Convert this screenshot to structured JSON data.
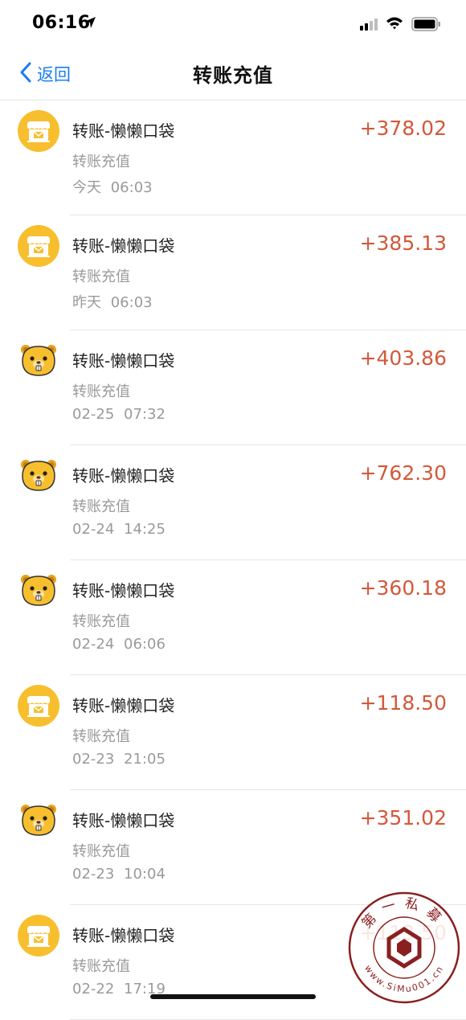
{
  "status": {
    "time": "06:16",
    "location_icon": "location-arrow-icon",
    "signal_icon": "cellular-signal-icon",
    "wifi_icon": "wifi-icon",
    "battery_icon": "battery-icon"
  },
  "nav": {
    "back_label": "返回",
    "title": "转账充值"
  },
  "colors": {
    "accent": "#1a7df5",
    "amount": "#d4583a",
    "secondary_text": "#9a9a9a",
    "icon_yellow": "#f7bf2e"
  },
  "transactions": [
    {
      "title": "转账-懒懒口袋",
      "subtitle": "转账充值",
      "time": "今天 06:03",
      "amount": "+378.02",
      "icon": "shop-icon"
    },
    {
      "title": "转账-懒懒口袋",
      "subtitle": "转账充值",
      "time": "昨天 06:03",
      "amount": "+385.13",
      "icon": "shop-icon"
    },
    {
      "title": "转账-懒懒口袋",
      "subtitle": "转账充值",
      "time": "02-25 07:32",
      "amount": "+403.86",
      "icon": "beaver-icon"
    },
    {
      "title": "转账-懒懒口袋",
      "subtitle": "转账充值",
      "time": "02-24 14:25",
      "amount": "+762.30",
      "icon": "beaver-icon"
    },
    {
      "title": "转账-懒懒口袋",
      "subtitle": "转账充值",
      "time": "02-24 06:06",
      "amount": "+360.18",
      "icon": "beaver-icon"
    },
    {
      "title": "转账-懒懒口袋",
      "subtitle": "转账充值",
      "time": "02-23 21:05",
      "amount": "+118.50",
      "icon": "shop-icon"
    },
    {
      "title": "转账-懒懒口袋",
      "subtitle": "转账充值",
      "time": "02-23 10:04",
      "amount": "+351.02",
      "icon": "beaver-icon"
    },
    {
      "title": "转账-懒懒口袋",
      "subtitle": "转账充值",
      "time": "02-22 17:19",
      "amount": "+113.50",
      "icon": "shop-icon"
    }
  ],
  "watermark": {
    "top_text": "第一私募",
    "bottom_text": "www.SiMu001.cn"
  }
}
